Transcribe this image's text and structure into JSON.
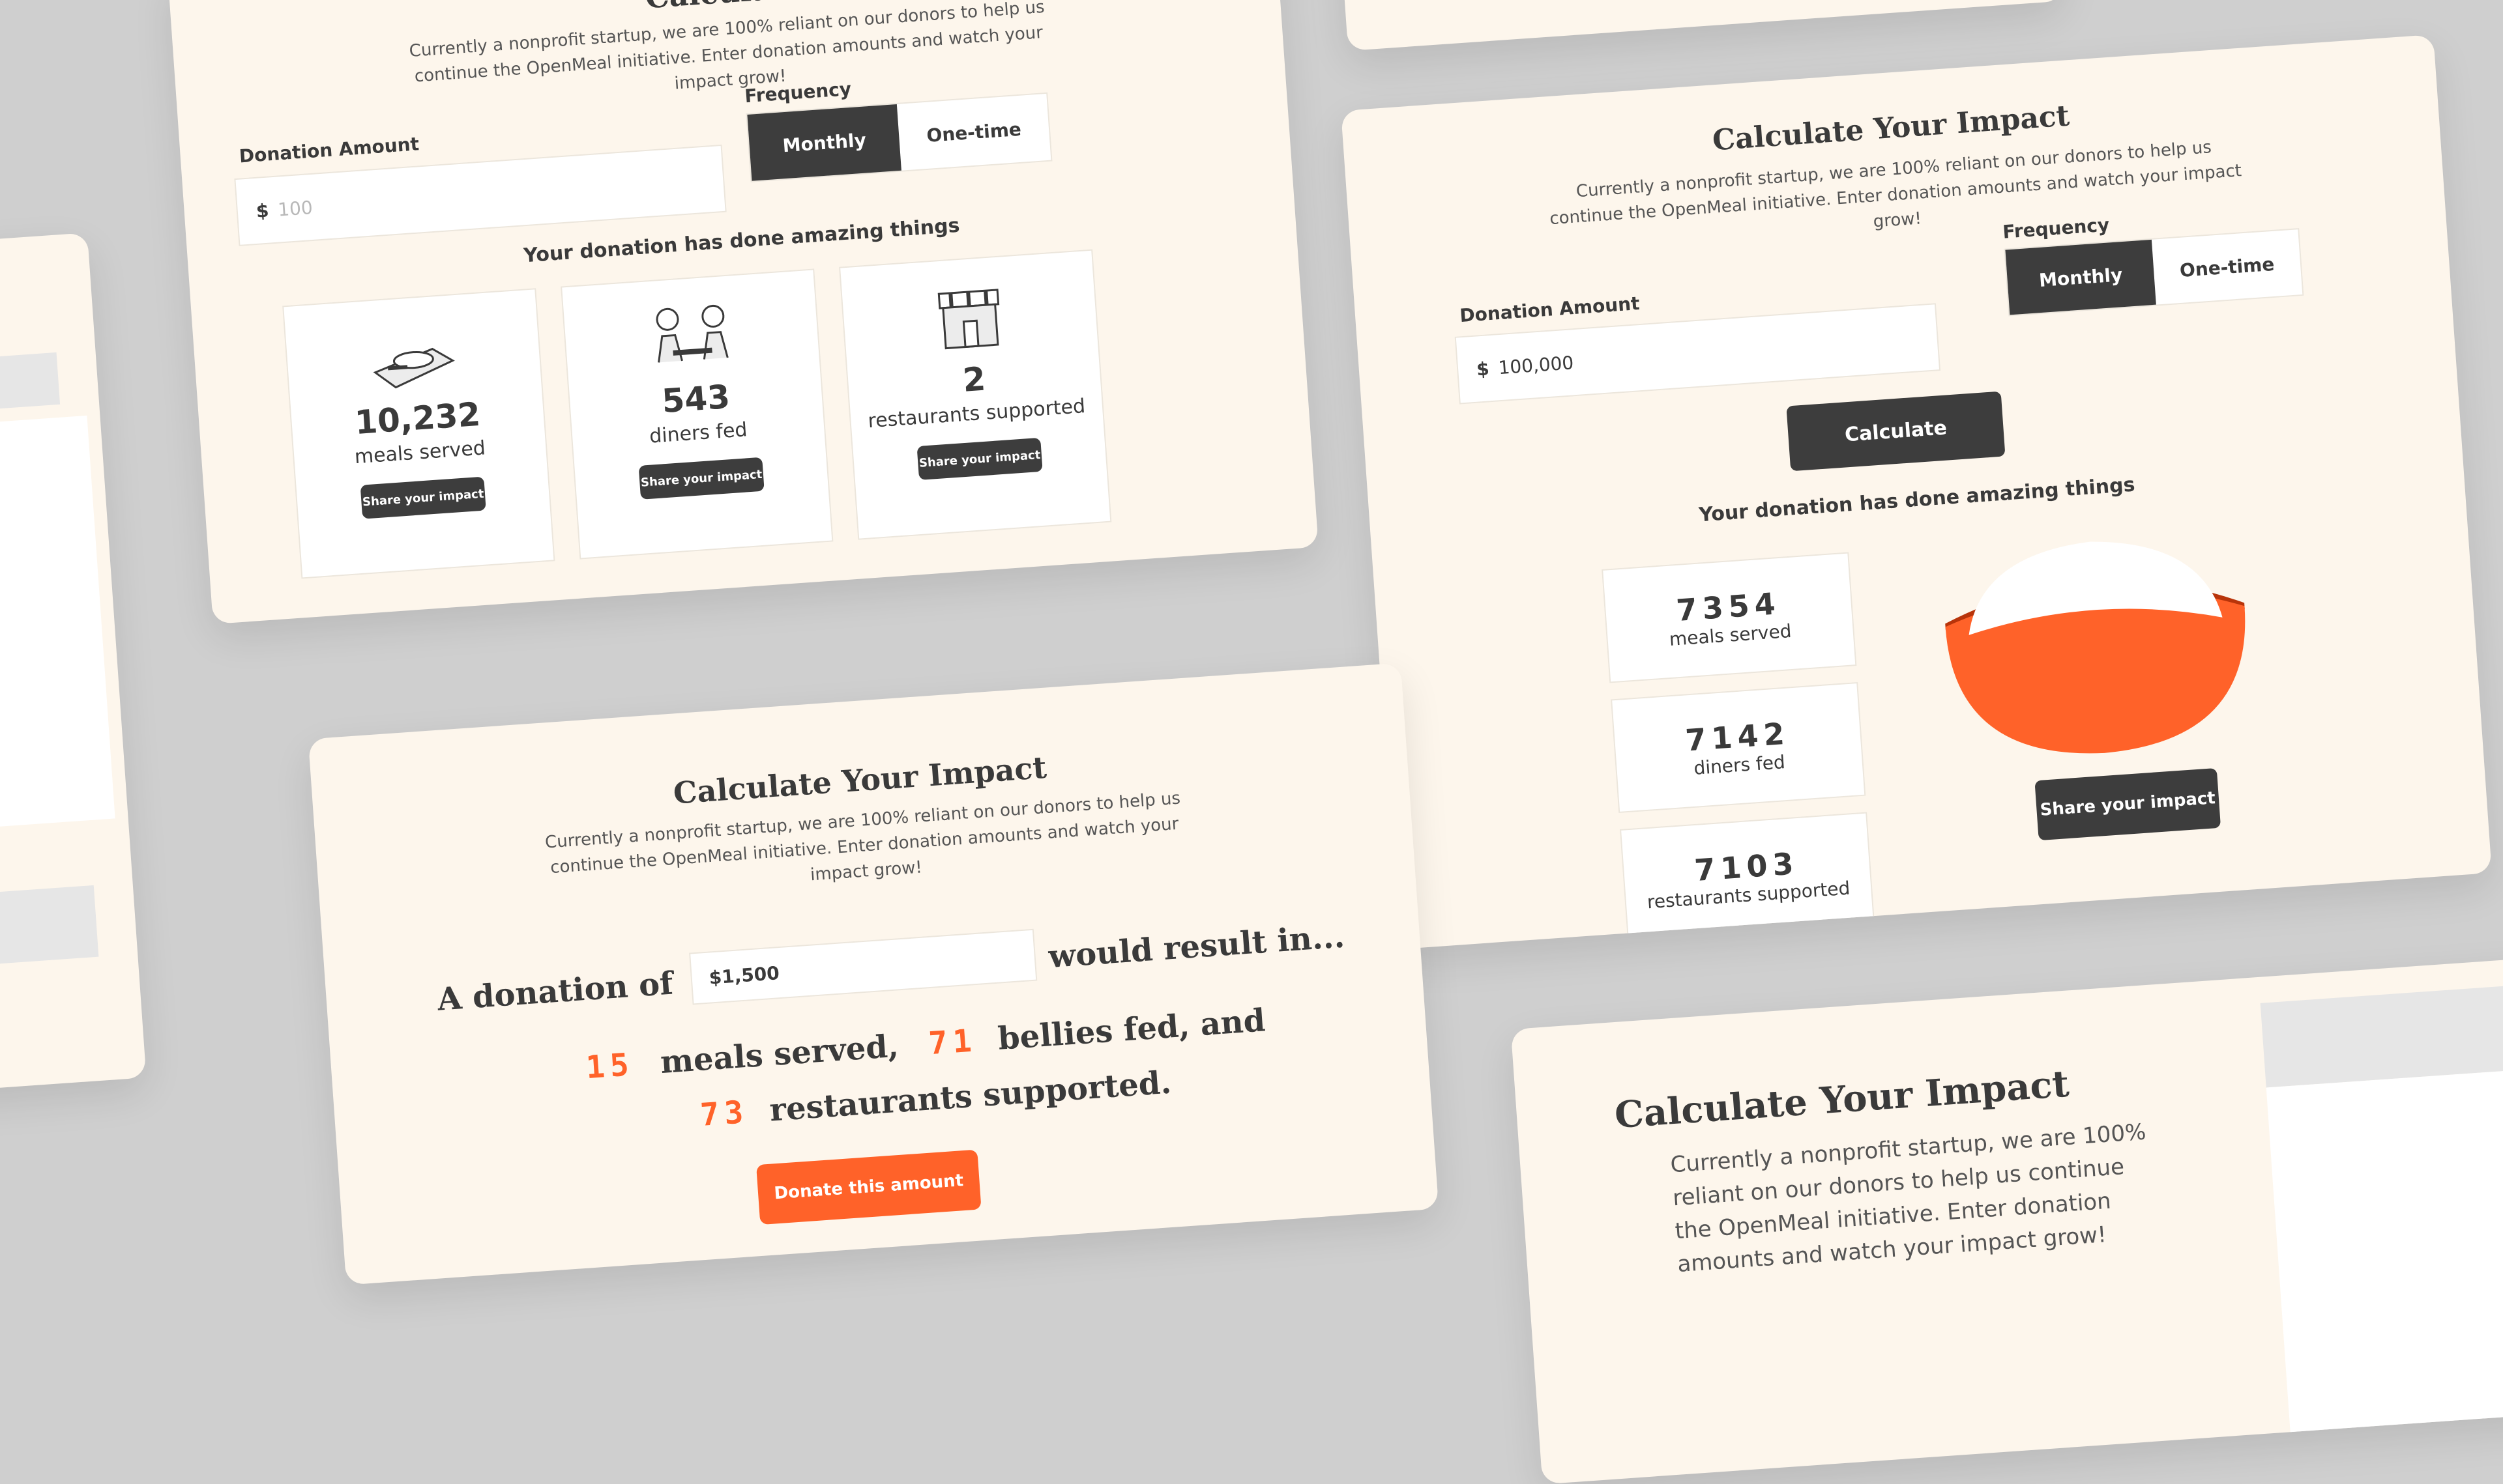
{
  "calculator": {
    "title": "Calculate Your Impact",
    "subtitle": "Currently a nonprofit startup, we are 100% reliant on our donors to help us continue the OpenMeal initiative. Enter donation amounts and watch your impact grow!"
  },
  "card_a": {
    "title_partial": "Calculate",
    "subtitle_partial": "Currently a nonprofit startup, we are 100% reliant on our donors to help us continue the OpenMeal initiative. Enter donation amounts and watch your impact grow!",
    "amount_label": "Donation Amount",
    "currency": "$",
    "amount_placeholder": "100",
    "frequency_label": "Frequency",
    "frequency_options": [
      "Monthly",
      "One-time"
    ],
    "frequency_selected": "Monthly",
    "heading": "Your donation has done amazing things",
    "stats": [
      {
        "value": "10,232",
        "label": "meals served",
        "button": "Share your impact",
        "icon": "meal-tray-icon"
      },
      {
        "value": "543",
        "label": "diners fed",
        "button": "Share your impact",
        "icon": "diners-icon"
      },
      {
        "value": "2",
        "label": "restaurants supported",
        "button": "Share your impact",
        "icon": "storefront-icon"
      }
    ]
  },
  "card_b": {
    "amount_label": "Donation Amount",
    "currency": "$",
    "amount_value": "100,000",
    "frequency_label": "Frequency",
    "frequency_options": [
      "Monthly",
      "One-time"
    ],
    "frequency_selected": "Monthly",
    "calculate_button": "Calculate",
    "heading": "Your donation has done amazing things",
    "stats": [
      {
        "value": "7354",
        "label": "meals served"
      },
      {
        "value": "7142",
        "label": "diners fed"
      },
      {
        "value": "7103",
        "label": "restaurants supported"
      }
    ],
    "illustration": "orange-bowl-icon",
    "share_button": "Share your impact"
  },
  "card_c": {
    "sentence_start": "A donation of",
    "amount_value": "$1,500",
    "sentence_result": "would result in...",
    "meals_value": "15",
    "meals_text": "meals served,",
    "bellies_value": "71",
    "bellies_text": "bellies fed, and",
    "restaurants_value": "73",
    "restaurants_text": "restaurants supported.",
    "donate_button": "Donate this amount"
  },
  "card_d": {
    "title": "Calculate Your Impact",
    "subtitle_partial": "Currently a nonprofit startup, we are 100% reliant on our donors to help us continue the OpenMeal initiative. Enter donation amounts and watch your impact grow!"
  },
  "colors": {
    "background": "#cfcfcf",
    "card": "#fdf6ec",
    "dark": "#3d3d3d",
    "accent": "#ff6229"
  }
}
